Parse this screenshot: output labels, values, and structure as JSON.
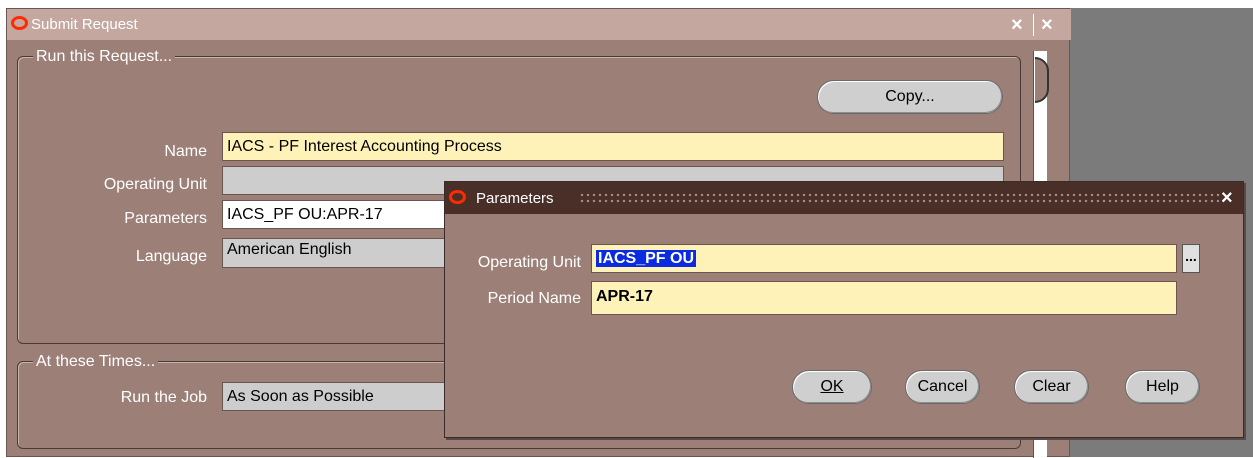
{
  "submit_request": {
    "title": "Submit Request",
    "close_glyph": "×",
    "run_section": {
      "title": "Run this Request...",
      "copy_button": "Copy...",
      "fields": [
        {
          "label": "Name",
          "value": "IACS - PF Interest Accounting Process"
        },
        {
          "label": "Operating Unit",
          "value": ""
        },
        {
          "label": "Parameters",
          "value": "IACS_PF OU:APR-17"
        },
        {
          "label": "Language",
          "value": "American English"
        }
      ]
    },
    "times_section": {
      "title": "At these Times...",
      "run_job_label": "Run the Job",
      "run_job_value": "As Soon as Possible"
    }
  },
  "parameters_dialog": {
    "title": "Parameters",
    "close_glyph": "×",
    "fields": [
      {
        "label": "Operating Unit",
        "value": "IACS_PF OU"
      },
      {
        "label": "Period Name",
        "value": "APR-17"
      }
    ],
    "lov_glyph": "...",
    "buttons": {
      "ok": "OK",
      "cancel": "Cancel",
      "clear": "Clear",
      "help": "Help"
    }
  },
  "colors": {
    "window_bg": "#9c8078",
    "titlebar_active": "#4a2f29",
    "required_field": "#fff2b8",
    "selection": "#0a2be0",
    "oracle_red": "#ff2a00"
  }
}
